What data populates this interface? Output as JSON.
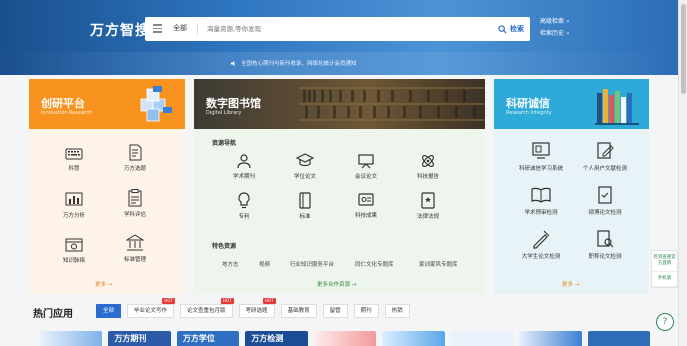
{
  "header": {
    "logo": "万方智搜",
    "search": {
      "scope": "全部",
      "placeholder": "海量资源,等你发现",
      "button": "检索"
    },
    "advanced_search": "高级检索",
    "search_history": "检索历史",
    "notice": "全国核心期刊与新刊收录、网络化统计会员通知"
  },
  "cards": {
    "innovation": {
      "title": "创研平台",
      "subtitle": "Innovation Research",
      "items": [
        "科慧",
        "万方选题",
        "万方分析",
        "学科评估",
        "知识脉络",
        "标准管理"
      ],
      "more": "更多"
    },
    "library": {
      "title": "数字图书馆",
      "subtitle": "Digital Library",
      "nav_title": "资源导航",
      "items": [
        "学术期刊",
        "学位论文",
        "会议论文",
        "科技报告",
        "专利",
        "标准",
        "科技成果",
        "法律法规"
      ],
      "featured_title": "特色资源",
      "featured": [
        "地方志",
        "视频",
        "行业知识服务平台",
        "同仁文化专题库",
        "家训家风专题库"
      ],
      "more": "更多合作资源"
    },
    "integrity": {
      "title": "科研诚信",
      "subtitle": "Research Integrity",
      "items": [
        "科研诚信学习系统",
        "个人用户文献检测",
        "学术预审检测",
        "硕博论文检测",
        "大学生论文检测",
        "职称论文检测"
      ],
      "more": "更多"
    }
  },
  "side": {
    "items": [
      "检测查重官方直销",
      "手机版"
    ],
    "help": "?"
  },
  "hot": {
    "title": "热门应用",
    "tabs": [
      {
        "label": "全部",
        "badge": "",
        "active": true
      },
      {
        "label": "毕业论文写作",
        "badge": "HOT",
        "active": false
      },
      {
        "label": "论文查重包月版",
        "badge": "HOT",
        "active": false
      },
      {
        "label": "考研选题",
        "badge": "HOT",
        "active": false
      },
      {
        "label": "基础教育",
        "badge": "",
        "active": false
      },
      {
        "label": "留管",
        "badge": "",
        "active": false
      },
      {
        "label": "期刊",
        "badge": "",
        "active": false
      },
      {
        "label": "热销",
        "badge": "",
        "active": false
      }
    ],
    "apps": [
      "",
      "万方期刊",
      "万方学位",
      "万方检测",
      "",
      "",
      "",
      "",
      ""
    ]
  },
  "colors": {
    "innovation": "#f7931e",
    "integrity": "#2eaad8",
    "library_accent": "#3a8a46",
    "primary": "#2a6bd0",
    "hot_badge": "#e53935"
  }
}
